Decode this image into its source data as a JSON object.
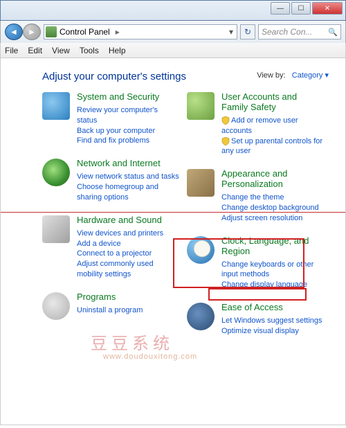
{
  "window": {
    "min_glyph": "—",
    "max_glyph": "☐",
    "close_glyph": "✕"
  },
  "nav": {
    "back_glyph": "◄",
    "fwd_glyph": "►",
    "breadcrumb": "Control Panel",
    "arrow": "▸",
    "dropdown_glyph": "▾",
    "refresh_glyph": "↻",
    "search_placeholder": "Search Con...",
    "search_glyph": "🔍"
  },
  "menu": {
    "file": "File",
    "edit": "Edit",
    "view": "View",
    "tools": "Tools",
    "help": "Help"
  },
  "page": {
    "heading": "Adjust your computer's settings",
    "viewby_label": "View by:",
    "viewby_value": "Category",
    "viewby_arrow": "▾"
  },
  "categories": {
    "system": {
      "title": "System and Security",
      "links": [
        "Review your computer's status",
        "Back up your computer",
        "Find and fix problems"
      ]
    },
    "network": {
      "title": "Network and Internet",
      "links": [
        "View network status and tasks",
        "Choose homegroup and sharing options"
      ]
    },
    "hardware": {
      "title": "Hardware and Sound",
      "links": [
        "View devices and printers",
        "Add a device",
        "Connect to a projector",
        "Adjust commonly used mobility settings"
      ]
    },
    "programs": {
      "title": "Programs",
      "links": [
        "Uninstall a program"
      ]
    },
    "user": {
      "title": "User Accounts and Family Safety",
      "links": [
        "Add or remove user accounts",
        "Set up parental controls for any user"
      ],
      "shielded": [
        true,
        true
      ]
    },
    "appearance": {
      "title": "Appearance and Personalization",
      "links": [
        "Change the theme",
        "Change desktop background",
        "Adjust screen resolution"
      ]
    },
    "clock": {
      "title": "Clock, Language, and Region",
      "links": [
        "Change keyboards or other input methods",
        "Change display language"
      ]
    },
    "ease": {
      "title": "Ease of Access",
      "links": [
        "Let Windows suggest settings",
        "Optimize visual display"
      ]
    }
  },
  "watermarks": {
    "w1": "豆豆系统",
    "w2": "www.doudouxitong.com"
  }
}
